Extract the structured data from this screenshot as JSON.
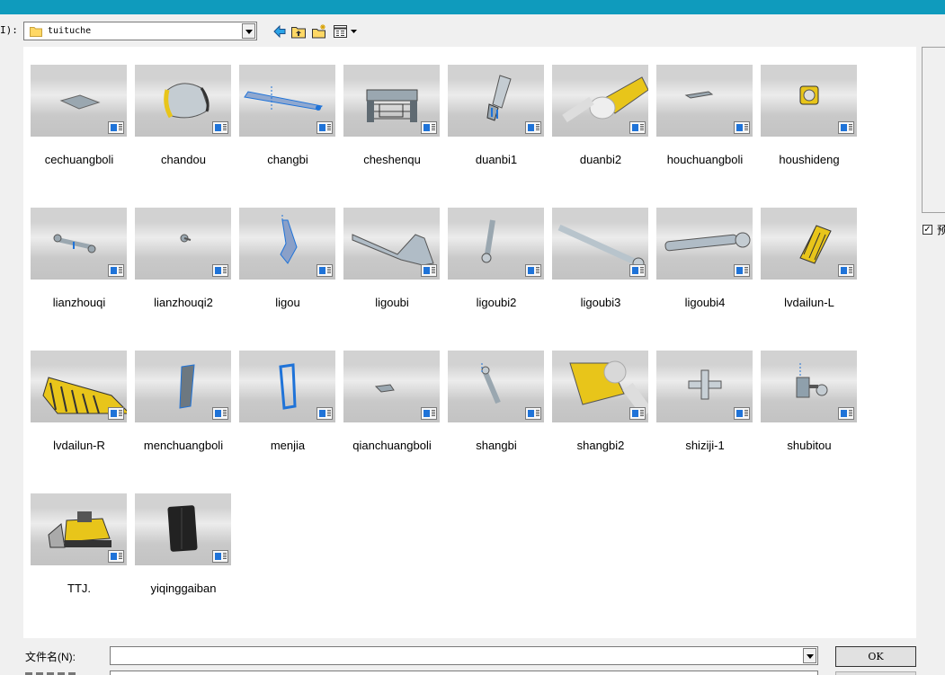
{
  "lookin": {
    "label": "I):",
    "folder": "tuituche"
  },
  "files": [
    {
      "name": "cechuangboli",
      "shape": "pane"
    },
    {
      "name": "chandou",
      "shape": "bucket"
    },
    {
      "name": "changbi",
      "shape": "long-arm"
    },
    {
      "name": "cheshenqu",
      "shape": "frame"
    },
    {
      "name": "duanbi1",
      "shape": "short-arm"
    },
    {
      "name": "duanbi2",
      "shape": "arm-yellow"
    },
    {
      "name": "houchuangboli",
      "shape": "pane-small"
    },
    {
      "name": "houshideng",
      "shape": "lamp"
    },
    {
      "name": "lianzhouqi",
      "shape": "pin"
    },
    {
      "name": "lianzhouqi2",
      "shape": "pin-small"
    },
    {
      "name": "ligou",
      "shape": "ripper"
    },
    {
      "name": "ligoubi",
      "shape": "ripper-arm"
    },
    {
      "name": "ligoubi2",
      "shape": "rod-short"
    },
    {
      "name": "ligoubi3",
      "shape": "rod-long"
    },
    {
      "name": "ligoubi4",
      "shape": "cylinder"
    },
    {
      "name": "lvdailun-L",
      "shape": "track-small"
    },
    {
      "name": "lvdailun-R",
      "shape": "track-large"
    },
    {
      "name": "menchuangboli",
      "shape": "door-glass"
    },
    {
      "name": "menjia",
      "shape": "door-frame"
    },
    {
      "name": "qianchuangboli",
      "shape": "pane-front"
    },
    {
      "name": "shangbi",
      "shape": "upper-arm"
    },
    {
      "name": "shangbi2",
      "shape": "upper-arm-yellow"
    },
    {
      "name": "shiziji-1",
      "shape": "cross"
    },
    {
      "name": "shubitou",
      "shape": "joint"
    },
    {
      "name": "TTJ.",
      "shape": "bulldozer"
    },
    {
      "name": "yiqinggaiban",
      "shape": "cover"
    }
  ],
  "preview_label": "预",
  "preview_checked": true,
  "filename": {
    "label": "文件名(N):",
    "value": ""
  },
  "ok_label": "OK",
  "colors": {
    "titlebar": "#0f9bbd",
    "part_blue": "#1f73d8",
    "part_yellow": "#e8c51a"
  }
}
